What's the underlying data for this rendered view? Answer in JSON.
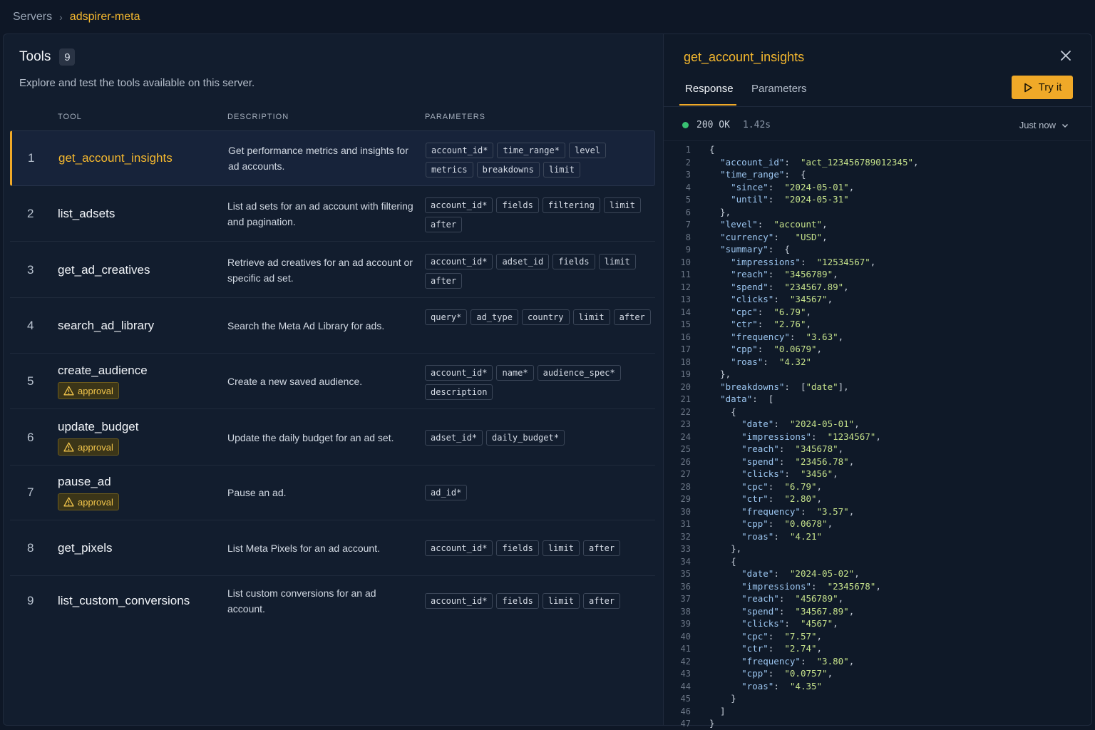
{
  "breadcrumb": {
    "parent": "Servers",
    "separator": "›",
    "current": "adspirer-meta"
  },
  "tools_panel": {
    "title": "Tools",
    "count": "9",
    "subtitle": "Explore and test the tools available on this server.",
    "columns": {
      "tool": "TOOL",
      "description": "DESCRIPTION",
      "parameters": "PARAMETERS"
    },
    "rows": [
      {
        "num": "1",
        "name": "get_account_insights",
        "desc": "Get performance metrics and insights for ad accounts.",
        "params": [
          "account_id*",
          "time_range*",
          "level",
          "metrics",
          "breakdowns",
          "limit"
        ],
        "approval": ""
      },
      {
        "num": "2",
        "name": "list_adsets",
        "desc": "List ad sets for an ad account with filtering and pagination.",
        "params": [
          "account_id*",
          "fields",
          "filtering",
          "limit",
          "after"
        ],
        "approval": ""
      },
      {
        "num": "3",
        "name": "get_ad_creatives",
        "desc": "Retrieve ad creatives for an ad account or specific ad set.",
        "params": [
          "account_id*",
          "adset_id",
          "fields",
          "limit",
          "after"
        ],
        "approval": ""
      },
      {
        "num": "4",
        "name": "search_ad_library",
        "desc": "Search the Meta Ad Library for ads.",
        "params": [
          "query*",
          "ad_type",
          "country",
          "limit",
          "after"
        ],
        "approval": ""
      },
      {
        "num": "5",
        "name": "create_audience",
        "desc": "Create a new saved audience.",
        "params": [
          "account_id*",
          "name*",
          "audience_spec*",
          "description"
        ],
        "approval": "approval"
      },
      {
        "num": "6",
        "name": "update_budget",
        "desc": "Update the daily budget for an ad set.",
        "params": [
          "adset_id*",
          "daily_budget*"
        ],
        "approval": "approval"
      },
      {
        "num": "7",
        "name": "pause_ad",
        "desc": "Pause an ad.",
        "params": [
          "ad_id*"
        ],
        "approval": "approval"
      },
      {
        "num": "8",
        "name": "get_pixels",
        "desc": "List Meta Pixels for an ad account.",
        "params": [
          "account_id*",
          "fields",
          "limit",
          "after"
        ],
        "approval": ""
      },
      {
        "num": "9",
        "name": "list_custom_conversions",
        "desc": "List custom conversions for an ad account.",
        "params": [
          "account_id*",
          "fields",
          "limit",
          "after"
        ],
        "approval": ""
      }
    ]
  },
  "detail_panel": {
    "title": "get_account_insights",
    "tabs": [
      "Response",
      "Parameters"
    ],
    "try_label": "Try it",
    "status_code": "200 OK",
    "duration": "1.42s",
    "timestamp": "Just now",
    "status_color": "#38c172",
    "accent": "#f0a928",
    "close_icon": "close-icon",
    "code_lines": [
      "{",
      "  \"account_id\":  \"act_123456789012345\",",
      "  \"time_range\":  {",
      "    \"since\":  \"2024-05-01\",",
      "    \"until\":  \"2024-05-31\"",
      "  },",
      "  \"level\":  \"account\",",
      "  \"currency\":   \"USD\",",
      "  \"summary\":  {",
      "    \"impressions\":  \"12534567\",",
      "    \"reach\":  \"3456789\",",
      "    \"spend\":  \"234567.89\",",
      "    \"clicks\":  \"34567\",",
      "    \"cpc\":  \"6.79\",",
      "    \"ctr\":  \"2.76\",",
      "    \"frequency\":  \"3.63\",",
      "    \"cpp\":  \"0.0679\",",
      "    \"roas\":  \"4.32\"",
      "  },",
      "  \"breakdowns\":  [\"date\"],",
      "  \"data\":  [",
      "    {",
      "      \"date\":  \"2024-05-01\",",
      "      \"impressions\":  \"1234567\",",
      "      \"reach\":  \"345678\",",
      "      \"spend\":  \"23456.78\",",
      "      \"clicks\":  \"3456\",",
      "      \"cpc\":  \"6.79\",",
      "      \"ctr\":  \"2.80\",",
      "      \"frequency\":  \"3.57\",",
      "      \"cpp\":  \"0.0678\",",
      "      \"roas\":  \"4.21\"",
      "    },",
      "    {",
      "      \"date\":  \"2024-05-02\",",
      "      \"impressions\":  \"2345678\",",
      "      \"reach\":  \"456789\",",
      "      \"spend\":  \"34567.89\",",
      "      \"clicks\":  \"4567\",",
      "      \"cpc\":  \"7.57\",",
      "      \"ctr\":  \"2.74\",",
      "      \"frequency\":  \"3.80\",",
      "      \"cpp\":  \"0.0757\",",
      "      \"roas\":  \"4.35\"",
      "    }",
      "  ]",
      "}"
    ]
  }
}
